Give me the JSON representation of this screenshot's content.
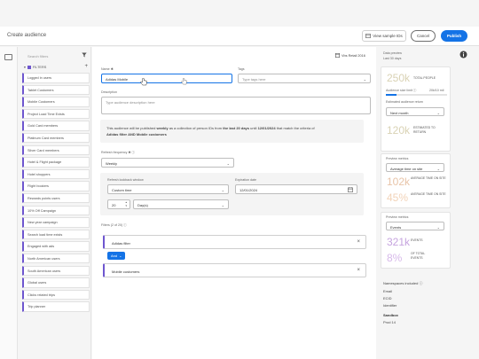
{
  "header": {
    "title": "Create audience",
    "view_ids_label": "View sample IDs",
    "cancel_label": "Cancel",
    "publish_label": "Publish"
  },
  "filters_panel": {
    "search_placeholder": "Search filters",
    "section_label": "FILTERS",
    "items": [
      "Logged in users",
      "Tablet Customers",
      "Mobile Customers",
      "Project Load Time Exists",
      "Gold Card members",
      "Platinum Card members",
      "Silver Card members",
      "Hotel & Flight package",
      "Hotel shoppers",
      "Flight bookers",
      "Rewards points users",
      "10% Off Campaign",
      "New year campaign",
      "Search load time exists",
      "Engaged with ads",
      "North American users",
      "South American users",
      "Global users",
      "Clicks related trips",
      "Trip planner"
    ]
  },
  "form": {
    "sandbox_label": "Vbs Retail 2016",
    "name_label": "Name ✱",
    "name_value": "Adidas Mobile",
    "tags_label": "Tags",
    "tags_placeholder": "Type tags here",
    "description_label": "Description",
    "description_placeholder": "Type audience description here",
    "info_line1_prefix": "This audience will be published ",
    "info_line1_weekly": "weekly",
    "info_line1_mid": " as a collection of person IDs from ",
    "info_line1_days": "the last 20 days",
    "info_line1_until": " until ",
    "info_line1_date": "12/01/2024",
    "info_line1_suffix": " that match the criteria of",
    "info_line2": "Adidas filter AND Mobile customers",
    "refresh_label": "Refresh frequency ✱ ⓘ",
    "refresh_value": "Weekly",
    "lookback_label": "Refresh lookback window",
    "lookback_value": "Custom time",
    "expiration_label": "Expiration date",
    "expiration_value": "12/01/2024",
    "stepper_value": "20",
    "period_value": "Day(s)",
    "filters_count_label": "Filters (2 of 20) ⓘ",
    "rule1": "Adidas filter",
    "and_label": "And",
    "rule2": "Mobile customers"
  },
  "preview": {
    "data_preview_label": "Data preview",
    "last_days": "Last 30 days",
    "people_value": "250k",
    "people_label": "TOTAL PEOPLE",
    "audience_size_label": "Audience size limit ⓘ",
    "audience_size_value": "20k/10 mil",
    "estimated_return_label": "Estimated audience return",
    "next_month": "Next month",
    "return_value": "120k",
    "return_label": "ESTIMATED TO RETURN",
    "preview_metrics_label": "Preview metrics",
    "metric_select": "Average time on site",
    "avg_value": "102k",
    "avg_label": "AVERAGE TIME ON SITE",
    "pct_value": "45%",
    "pct_label": "AVERAGE TIME ON SITE",
    "metrics2_label": "Preview metrics",
    "events_select": "Events",
    "events_value": "321k",
    "events_label": "EVENTS",
    "events_pct_value": "8%",
    "events_pct_label": "OF TOTAL EVENTS",
    "namespaces_label": "Namespaces included ⓘ",
    "namespaces": [
      "Email",
      "ECID",
      "Identifier"
    ],
    "sandbox_label": "Sandbox",
    "sandbox_value": "Prod 14"
  },
  "colors": {
    "accent": "#1473e6",
    "filter_accent": "#6e56cf",
    "metric_tint": "#d9d2b4"
  }
}
